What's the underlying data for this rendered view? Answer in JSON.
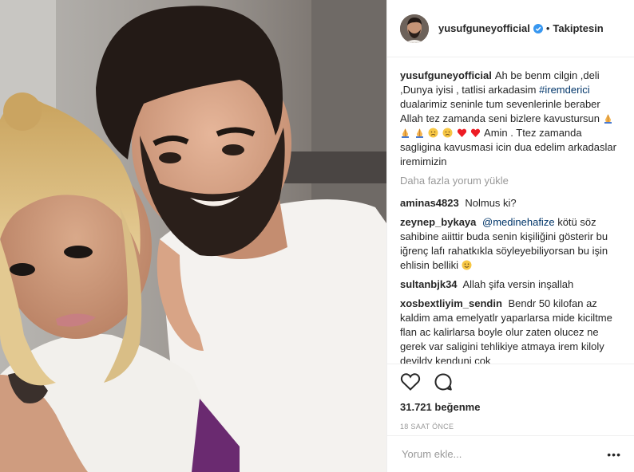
{
  "header": {
    "username": "yusufguneyofficial",
    "separator": "•",
    "follow_label": "Takiptesin"
  },
  "caption": {
    "username": "yusufguneyofficial",
    "text_1": "Ah be benm cilgin ,deli ,Dunya iyisi , tatlisi arkadasim",
    "hashtag": "#iremderici",
    "text_2": "dualarimiz seninle tum sevenlerinle beraber Allah tez zamanda seni bizlere kavustursun",
    "text_3": "Amin . Ttez zamanda sagligina kavusmasi icin dua edelim arkadaslar iremimizin"
  },
  "load_more": "Daha fazla yorum yükle",
  "comments": [
    {
      "user": "aminas4823",
      "text": "Nolmus ki?"
    },
    {
      "user": "zeynep_bykaya",
      "mention": "@medinehafize",
      "text": "kötü söz sahibine aiittir buda senin kişiliğini gösterir bu iğrenç lafı rahatkıkla söyleyebiliyorsan bu işin ehlisin belliki"
    },
    {
      "user": "sultanbjk34",
      "text": "Allah şifa versin inşallah"
    },
    {
      "user": "xosbextliyim_sendin",
      "text": "Bendr 50 kilofan az kaldim ama emelyatlr yaparlarsa mide kiciltme flan ac kalirlarsa boyle olur zaten olucez ne gerek var saligini tehlikiye atmaya irem kiloly devildy kenduni cok"
    }
  ],
  "likes": "31.721 beğenme",
  "time": "18 SAAT ÖNCE",
  "add_comment": {
    "placeholder": "Yorum ekle..."
  },
  "options_glyph": "•••",
  "colors": {
    "verified": "#3897f0",
    "heart": "#ed1c24",
    "hashtag": "#003569",
    "muted": "#999999"
  },
  "icons": [
    "verified-icon",
    "like-heart-icon",
    "comment-bubble-icon",
    "more-options-icon"
  ]
}
